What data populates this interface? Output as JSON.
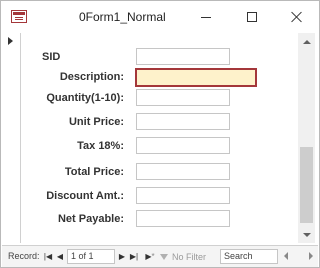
{
  "window": {
    "title": "0Form1_Normal",
    "accent": "#a4373a"
  },
  "form": {
    "fields": [
      {
        "label": "SID",
        "value": ""
      },
      {
        "label": "Description:",
        "value": ""
      },
      {
        "label": "Quantity(1-10):",
        "value": ""
      },
      {
        "label": "Unit Price:",
        "value": ""
      },
      {
        "label": "Tax 18%:",
        "value": ""
      },
      {
        "label": "Total Price:",
        "value": ""
      },
      {
        "label": "Discount Amt.:",
        "value": ""
      },
      {
        "label": "Net Payable:",
        "value": ""
      }
    ],
    "focused_field_color": "#fef2cb"
  },
  "navigation": {
    "record_label": "Record:",
    "position": "1 of 1",
    "filter_label": "No Filter",
    "search_placeholder": "Search",
    "icons": {
      "first": "first-record-icon",
      "prev": "previous-record-icon",
      "next": "next-record-icon",
      "last": "last-record-icon",
      "new": "new-record-icon",
      "filter": "filter-icon"
    }
  }
}
